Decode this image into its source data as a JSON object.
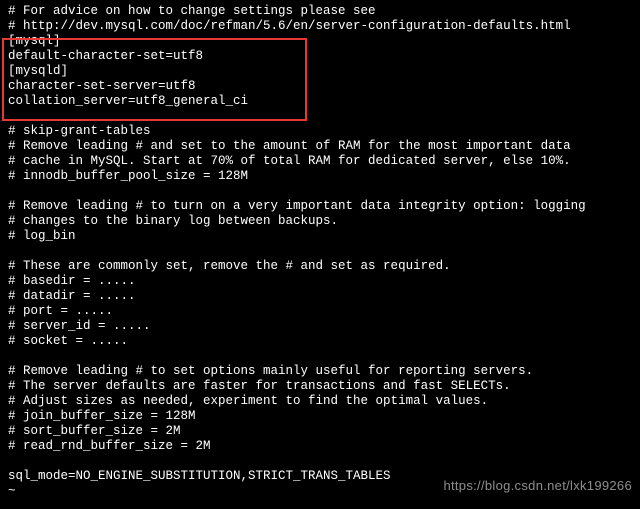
{
  "lines": [
    "# For advice on how to change settings please see",
    "# http://dev.mysql.com/doc/refman/5.6/en/server-configuration-defaults.html",
    "[mysql]",
    "default-character-set=utf8",
    "[mysqld]",
    "character-set-server=utf8",
    "collation_server=utf8_general_ci",
    "",
    "# skip-grant-tables",
    "# Remove leading # and set to the amount of RAM for the most important data",
    "# cache in MySQL. Start at 70% of total RAM for dedicated server, else 10%.",
    "# innodb_buffer_pool_size = 128M",
    "",
    "# Remove leading # to turn on a very important data integrity option: logging",
    "# changes to the binary log between backups.",
    "# log_bin",
    "",
    "# These are commonly set, remove the # and set as required.",
    "# basedir = .....",
    "# datadir = .....",
    "# port = .....",
    "# server_id = .....",
    "# socket = .....",
    "",
    "# Remove leading # to set options mainly useful for reporting servers.",
    "# The server defaults are faster for transactions and fast SELECTs.",
    "# Adjust sizes as needed, experiment to find the optimal values.",
    "# join_buffer_size = 128M",
    "# sort_buffer_size = 2M",
    "# read_rnd_buffer_size = 2M",
    "",
    "sql_mode=NO_ENGINE_SUBSTITUTION,STRICT_TRANS_TABLES",
    "~"
  ],
  "watermark": "https://blog.csdn.net/lxk199266"
}
